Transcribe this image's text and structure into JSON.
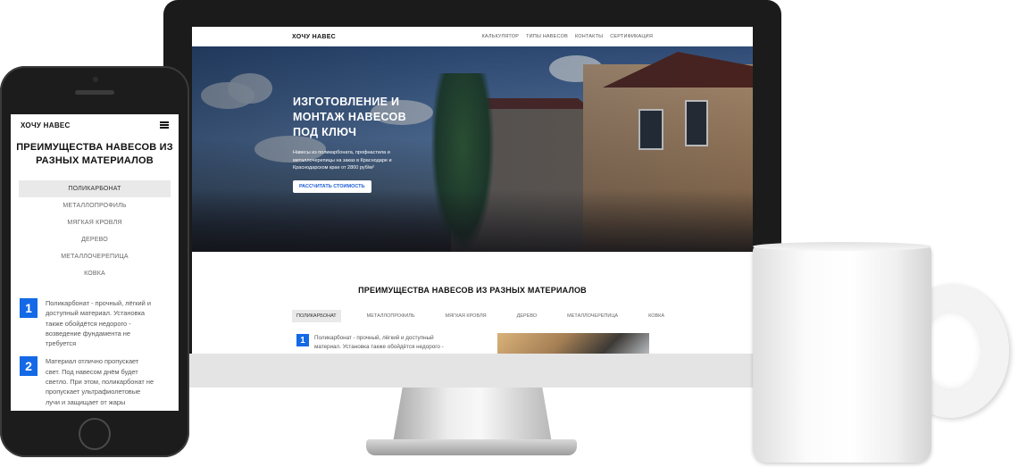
{
  "desktop": {
    "nav": {
      "logo": "ХОЧУ НАВЕС",
      "menu": [
        "КАЛЬКУЛЯТОР",
        "ТИПЫ НАВЕСОВ",
        "КОНТАКТЫ",
        "СЕРТИФИКАЦИЯ"
      ]
    },
    "hero": {
      "title": "ИЗГОТОВЛЕНИЕ И\nМОНТАЖ НАВЕСОВ\nПОД КЛЮЧ",
      "subtitle": "Навесы из поликарбоната, профнастила и\nметаллочерепицы на заказ в Краснодаре и\nКраснодарском крае от 2800 руб/м²",
      "button": "РАССЧИТАТЬ СТОИМОСТЬ"
    },
    "section": {
      "title": "ПРЕИМУЩЕСТВА НАВЕСОВ ИЗ РАЗНЫХ МАТЕРИАЛОВ",
      "tabs": [
        "ПОЛИКАРБОНАТ",
        "МЕТАЛЛОПРОФИЛЬ",
        "МЯГКАЯ КРОВЛЯ",
        "ДЕРЕВО",
        "МЕТАЛЛОЧЕРЕПИЦА",
        "КОВКА"
      ],
      "active_tab": 0,
      "features": [
        {
          "number": "1",
          "text": "Поликарбонат - прочный, лёгкий и доступный\nматериал. Установка также обойдётся недорого -"
        }
      ]
    }
  },
  "mobile": {
    "nav": {
      "logo": "ХОЧУ НАВЕС"
    },
    "section": {
      "title": "ПРЕИМУЩЕСТВА НАВЕСОВ ИЗ\nРАЗНЫХ МАТЕРИАЛОВ",
      "tabs": [
        "ПОЛИКАРБОНАТ",
        "МЕТАЛЛОПРОФИЛЬ",
        "МЯГКАЯ КРОВЛЯ",
        "ДЕРЕВО",
        "МЕТАЛЛОЧЕРЕПИЦА",
        "КОВКА"
      ],
      "active_tab": 0,
      "features": [
        {
          "number": "1",
          "text": "Поликарбонат - прочный, лёгкий и\nдоступный материал. Установка\nтакже обойдётся недорого -\nвозведение фундамента не\nтребуется"
        },
        {
          "number": "2",
          "text": "Материал отлично пропускает\nсвет. Под навесом днём будет\nсветло. При этом, поликарбонат не\nпропускает ультрафиолетовые\nлучи и защищает от жары"
        }
      ]
    }
  },
  "colors": {
    "accent": "#1469e6",
    "button_text": "#1f5ed6",
    "active_tab_bg": "#e9e9e9"
  },
  "icons": [
    "hamburger-menu-icon"
  ]
}
